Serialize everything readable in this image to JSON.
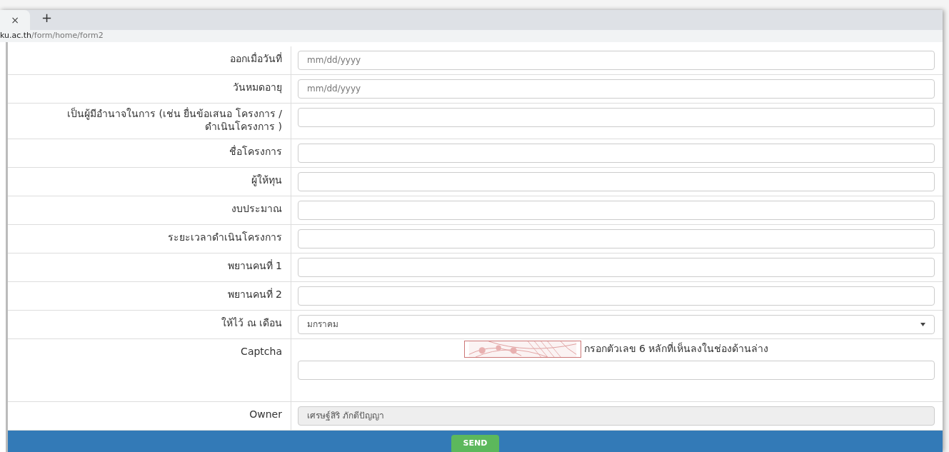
{
  "browser": {
    "tab_close": "×",
    "new_tab": "+",
    "url_host": "ku.ac.th",
    "url_path": "/form/home/form2"
  },
  "rows": [
    {
      "kind": "date",
      "label": "ออกเมื่อวันที่",
      "placeholder": "mm/dd/yyyy"
    },
    {
      "kind": "date",
      "label": "วันหมดอายุ",
      "placeholder": "mm/dd/yyyy"
    },
    {
      "kind": "text",
      "label": "เป็นผู้มีอำนาจในการ (เช่น ยื่นข้อเสนอ โครงการ /ดำเนินโครงการ )"
    },
    {
      "kind": "text",
      "label": "ชื่อโครงการ"
    },
    {
      "kind": "text",
      "label": "ผู้ให้ทุน"
    },
    {
      "kind": "text",
      "label": "งบประมาณ"
    },
    {
      "kind": "text",
      "label": "ระยะเวลาดำเนินโครงการ"
    },
    {
      "kind": "text",
      "label": "พยานคนที่ 1"
    },
    {
      "kind": "text",
      "label": "พยานคนที่ 2"
    },
    {
      "kind": "select",
      "label": "ให้ไว้ ณ เดือน",
      "value": "มกราคม"
    },
    {
      "kind": "captcha",
      "label": "Captcha",
      "hint": "กรอกตัวเลข 6 หลักที่เห็นลงในช่องด้านล่าง"
    },
    {
      "kind": "readonly",
      "label": "Owner",
      "value": "เศรษฐ์สิริ ภักดีปัญญา",
      "disabled": true
    }
  ],
  "send_button": "SEND"
}
